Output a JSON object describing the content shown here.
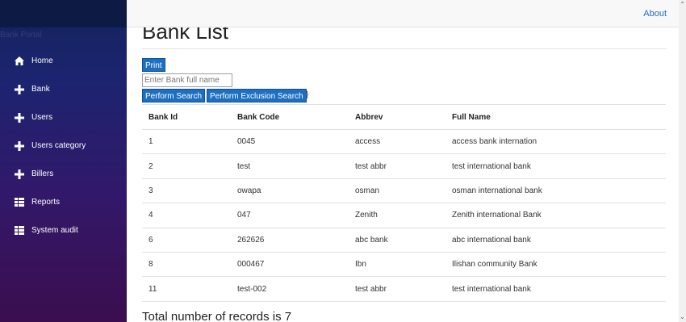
{
  "sidebar": {
    "brand": "Bank Portal",
    "items": [
      {
        "label": "Home",
        "icon": "home-icon"
      },
      {
        "label": "Bank",
        "icon": "plus-icon"
      },
      {
        "label": "Users",
        "icon": "plus-icon"
      },
      {
        "label": "Users category",
        "icon": "plus-icon"
      },
      {
        "label": "Billers",
        "icon": "plus-icon"
      },
      {
        "label": "Reports",
        "icon": "list-icon"
      },
      {
        "label": "System audit",
        "icon": "list-icon"
      }
    ]
  },
  "topbar": {
    "about_label": "About"
  },
  "page": {
    "title": "Bank List",
    "print_label": "Print",
    "search_placeholder": "Enter Bank full name",
    "search_label": "Perform Search",
    "exclusion_label": "Perform Exclusion Search",
    "stray_brace": "}",
    "total_text": "Total number of records is 7"
  },
  "table": {
    "headers": [
      "Bank Id",
      "Bank Code",
      "Abbrev",
      "Full Name"
    ],
    "rows": [
      [
        "1",
        "0045",
        "access",
        "access bank internation"
      ],
      [
        "2",
        "test",
        "test abbr",
        "test international bank"
      ],
      [
        "3",
        "owapa",
        "osman",
        "osman international bank"
      ],
      [
        "4",
        "047",
        "Zenith",
        "Zenith international Bank"
      ],
      [
        "6",
        "262626",
        "abc bank",
        "abc international bank"
      ],
      [
        "8",
        "000467",
        "Ibn",
        "Ilishan community Bank"
      ],
      [
        "11",
        "test-002",
        "test abbr",
        "test international bank"
      ]
    ]
  },
  "colors": {
    "primary": "#1d6fc1",
    "link": "#1e6fc2",
    "sidebar_top": "#13235c",
    "sidebar_bottom": "#3b0e4f"
  }
}
